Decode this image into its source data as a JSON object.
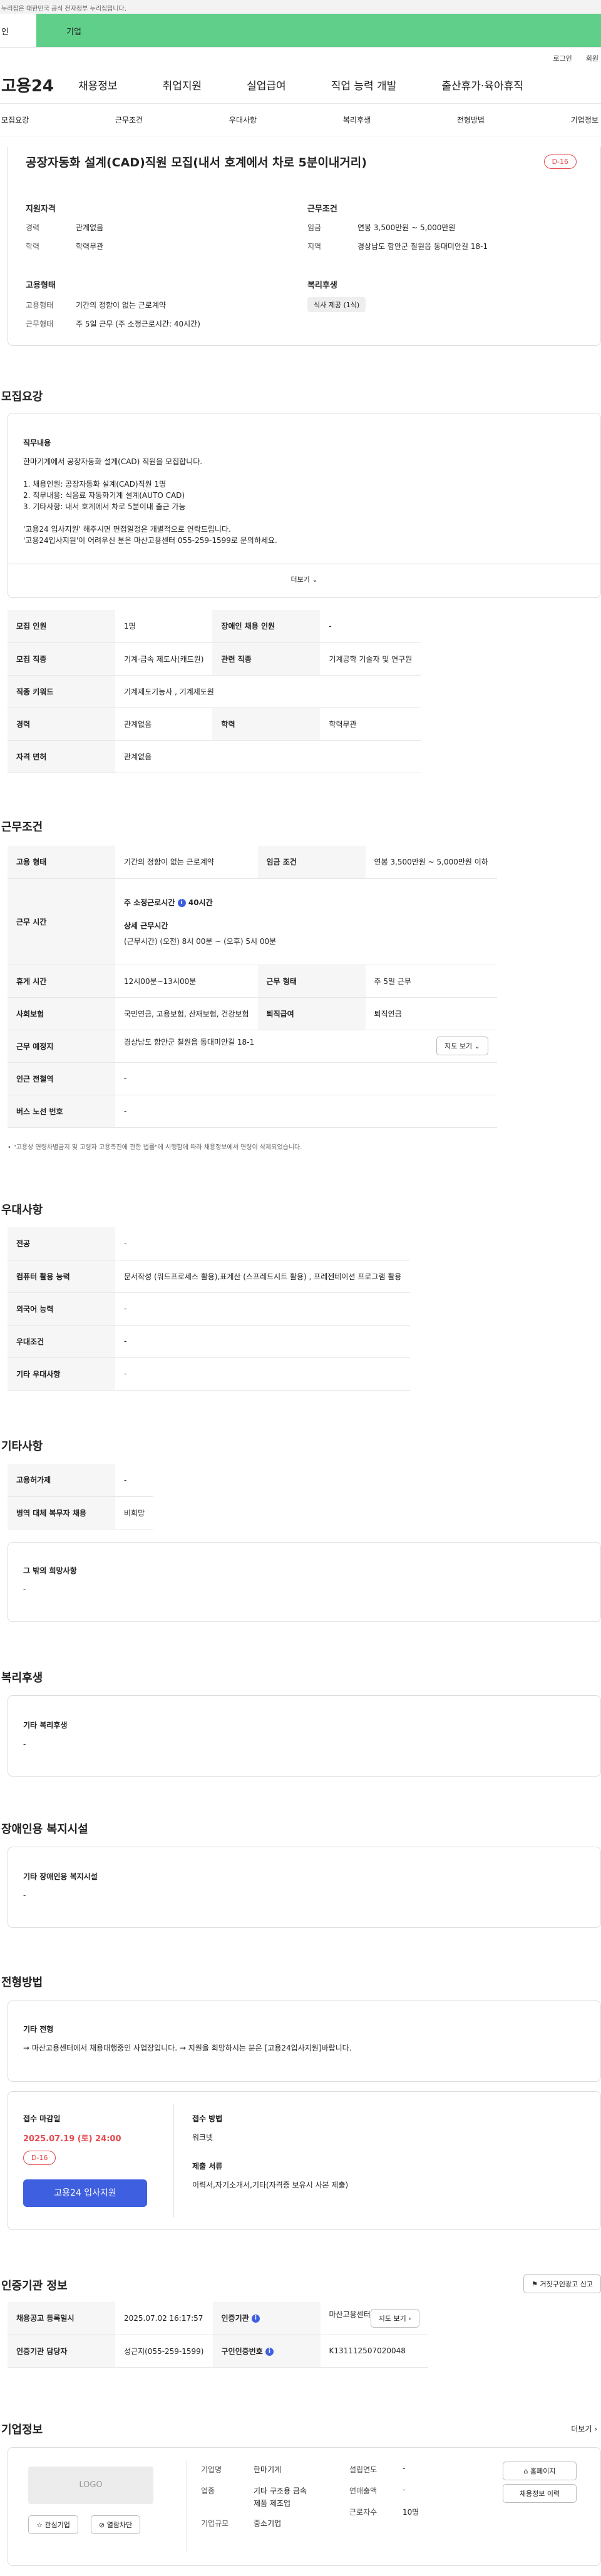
{
  "topbar": "누리집은 대한민국 공식 전자정부 누리집입니다.",
  "tabs": [
    "인",
    "기업"
  ],
  "util": [
    "로그인",
    "회원"
  ],
  "logo": "고용24",
  "gnb": [
    "채용정보",
    "취업지원",
    "실업급여",
    "직업 능력 개발",
    "출산휴가·육아휴직"
  ],
  "subnav": [
    "모집요강",
    "근무조건",
    "우대사항",
    "복리후생",
    "전형방법",
    "기업정보"
  ],
  "job": {
    "title": "공장자동화 설계(CAD)직원 모집(내서 호계에서 차로 5분이내거리)",
    "dday": "D-16"
  },
  "summary": {
    "qual_title": "지원자격",
    "career_k": "경력",
    "career_v": "관계없음",
    "edu_k": "학력",
    "edu_v": "학력무관",
    "cond_title": "근무조건",
    "wage_k": "임금",
    "wage_v": "연봉 3,500만원 ~ 5,000만원",
    "area_k": "지역",
    "area_v": "경상남도 함안군 칠원읍 동대미안길 18-1",
    "emp_title": "고용형태",
    "emptype_k": "고용형태",
    "emptype_v": "기간의 정함이 없는 근로계약",
    "worktype_k": "근무형태",
    "worktype_v": "주 5일 근무 (주 소정근로시간: 40시간)",
    "welfare_title": "복리후생",
    "welfare_tag": "식사 제공 (1식)"
  },
  "recruit": {
    "title": "모집요강",
    "duty_title": "직무내용",
    "duty_lines": [
      "한마기계에서 공장자동화 설계(CAD) 직원을 모집합니다.",
      "",
      "1. 채용인원: 공장자동화 설계(CAD)직원 1명",
      "2. 직무내용: 식음료 자동화기계 설계(AUTO CAD)",
      "3. 기타사항: 내서 호계에서 차로 5분이내 출근 가능",
      "",
      "'고용24 입사지원' 해주시면 면접일정은 개별적으로 연락드립니다.",
      "'고용24입사지원'이 어려우신 분은 마산고용센터 055-259-1599로 문의하세요."
    ],
    "more": "더보기",
    "rows": [
      [
        "모집 인원",
        "1명",
        "장애인 채용 인원",
        "-"
      ],
      [
        "모집 직종",
        "기계·금속 제도사(캐드원)",
        "관련 직종",
        "기계공학 기술자 및 연구원"
      ],
      [
        "직종 키워드",
        "기계제도기능사 , 기계제도원"
      ],
      [
        "경력",
        "관계없음",
        "학력",
        "학력무관"
      ],
      [
        "자격 면허",
        "관계없음"
      ]
    ]
  },
  "work": {
    "title": "근무조건",
    "emp_k": "고용 형태",
    "emp_v": "기간의 정함이 없는 근로계약",
    "wage_k": "임금 조건",
    "wage_v": "연봉 3,500만원 ~ 5,000만원 이하",
    "hours_k": "근무 시간",
    "hours_main": "주 소정근로시간",
    "hours_val": "40시간",
    "hours_detail_title": "상세 근무시간",
    "hours_detail": "(근무시간) (오전) 8시 00분 ~ (오후) 5시 00분",
    "break_k": "휴게 시간",
    "break_v": "12시00분~13시00분",
    "form_k": "근무 형태",
    "form_v": "주 5일 근무",
    "ins_k": "사회보험",
    "ins_v": "국민연금, 고용보험, 산재보험, 건강보험",
    "ret_k": "퇴직급여",
    "ret_v": "퇴직연금",
    "place_k": "근무 예정지",
    "place_v": "경상남도 함안군 칠원읍 동대미안길 18-1",
    "map_btn": "지도 보기",
    "station_k": "인근 전철역",
    "station_v": "-",
    "bus_k": "버스 노선 번호",
    "bus_v": "-",
    "note": "\"고용상 연령차별금지 및 고령자 고용촉진에 관한 법률\"에 시행함에 따라 채용정보에서 연령이 삭제되었습니다."
  },
  "pref": {
    "title": "우대사항",
    "rows": [
      [
        "전공",
        "-"
      ],
      [
        "컴퓨터 활용 능력",
        "문서작성 (워드프로세스 활용),표계산 (스프레드시트 활용) , 프레젠테이션 프로그램 활용"
      ],
      [
        "외국어 능력",
        "-"
      ],
      [
        "우대조건",
        "-"
      ],
      [
        "기타 우대사항",
        "-"
      ]
    ]
  },
  "etc": {
    "title": "기타사항",
    "rows": [
      [
        "고용허가제",
        "-"
      ],
      [
        "병역 대체 복무자 채용",
        "비희망"
      ]
    ],
    "hope_title": "그 밖의 희망사항",
    "hope_v": "-"
  },
  "welfare": {
    "title": "복리후생",
    "sub": "기타 복리후생",
    "v": "-"
  },
  "disab": {
    "title": "장애인용 복지시설",
    "sub": "기타 장애인용 복지시설",
    "v": "-"
  },
  "select": {
    "title": "전형방법",
    "sub": "기타 전형",
    "v": "→ 마산고용센터에서 채용대행중인 사업장입니다. → 지원을 희망하시는 분은 [고용24입사지원]바랍니다.",
    "deadline_title": "접수 마감일",
    "deadline": "2025.07.19 (토) 24:00",
    "dday": "D-16",
    "apply": "고용24 입사지원",
    "method_title": "접수 방법",
    "method_v": "워크넷",
    "docs_title": "제출 서류",
    "docs_v": "이력서,자기소개서,기타(자격증 보유시 사본 제출)"
  },
  "agency": {
    "title": "인증기관 정보",
    "report_btn": "거짓구인광고 신고",
    "reg_k": "채용공고 등록일시",
    "reg_v": "2025.07.02 16:17:57",
    "org_k": "인증기관",
    "org_v": "마산고용센터",
    "map_btn": "지도 보기",
    "mgr_k": "인증기관 담당자",
    "mgr_v": "성근지(055-259-1599)",
    "id_k": "구인인증번호",
    "id_v": "K131112507020048"
  },
  "company": {
    "title": "기업정보",
    "more": "더보기",
    "logo": "LOGO",
    "fav": "관심기업",
    "block": "열람차단",
    "name_k": "기업명",
    "name_v": "한마기계",
    "ind_k": "업종",
    "ind_v1": "기타 구조용 금속",
    "ind_v2": "제품 제조업",
    "size_k": "기업규모",
    "size_v": "중소기업",
    "est_k": "설립연도",
    "est_v": "-",
    "sales_k": "연매출액",
    "sales_v": "-",
    "emp_k": "근로자수",
    "emp_v": "10명",
    "home_btn": "홈페이지",
    "jobs_btn": "채용정보 이력"
  }
}
